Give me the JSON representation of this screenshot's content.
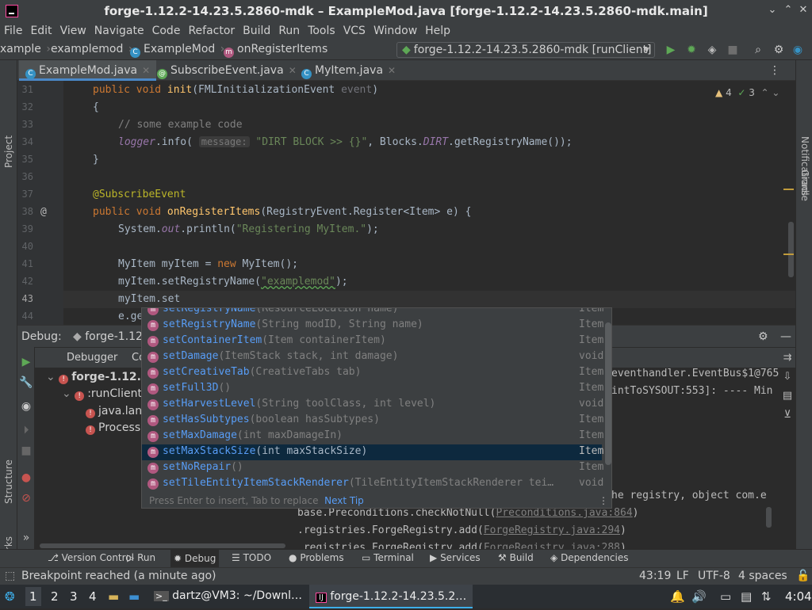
{
  "window": {
    "title": "forge-1.12.2-14.23.5.2860-mdk – ExampleMod.java [forge-1.12.2-14.23.5.2860-mdk.main]"
  },
  "menu": [
    "File",
    "Edit",
    "View",
    "Navigate",
    "Code",
    "Refactor",
    "Build",
    "Run",
    "Tools",
    "VCS",
    "Window",
    "Help"
  ],
  "breadcrumbs": {
    "c1": "xample",
    "c2": "examplemod",
    "c3": "ExampleMod",
    "c4": "onRegisterItems"
  },
  "run_config": "forge-1.12.2-14.23.5.2860-mdk [runClient]",
  "tabs": [
    "ExampleMod.java",
    "SubscribeEvent.java",
    "MyItem.java"
  ],
  "inspections": {
    "warnings": "4",
    "ok": "3"
  },
  "side_labels": {
    "project": "Project",
    "notifications": "Notifications",
    "gradle": "Gradle",
    "structure": "Structure",
    "bookmarks": "Bookmarks"
  },
  "code": {
    "line_numbers": [
      "31",
      "32",
      "33",
      "34",
      "35",
      "36",
      "37",
      "38",
      "39",
      "40",
      "41",
      "42",
      "43",
      "44"
    ],
    "l31_kw": "public void ",
    "l31_fn": "init",
    "l31_rest": "(FMLInitializationEvent ",
    "l31_par": "event",
    ")": ")",
    "l32": "{",
    "l33": "// some example code",
    "l34_a": "logger",
    "l34_b": ".info( ",
    "l34_hint": "message:",
    "l34_str": " \"DIRT BLOCK >> {}\"",
    "l34_c": ", Blocks.",
    "l34_st": "DIRT",
    "l34_d": ".getRegistryName());",
    "l35": "}",
    "l37": "@SubscribeEvent",
    "l38_kw": "public void ",
    "l38_fn": "onRegisterItems",
    "l38_rest": "(RegistryEvent.Register<Item> e) {",
    "l39_a": "System.",
    "l39_st": "out",
    "l39_b": ".println(",
    "l39_str": "\"Registering MyItem.\"",
    "l39_c": ");",
    "l41_a": "MyItem myItem = ",
    "l41_kw": "new ",
    "l41_b": "MyItem();",
    "l42_a": "myItem.setRegistryName(",
    "l42_str": "\"examplemod\"",
    "l42_b": ");",
    "l43": "myItem.set",
    "l44": "e.ge"
  },
  "completion": {
    "items": [
      {
        "name": "setRegistryName",
        "params": "(ResourceLocation name)",
        "ret": "Item"
      },
      {
        "name": "setRegistryName",
        "params": "(String modID, String name)",
        "ret": "Item"
      },
      {
        "name": "setContainerItem",
        "params": "(Item containerItem)",
        "ret": "Item"
      },
      {
        "name": "setDamage",
        "params": "(ItemStack stack, int damage)",
        "ret": "void"
      },
      {
        "name": "setCreativeTab",
        "params": "(CreativeTabs tab)",
        "ret": "Item"
      },
      {
        "name": "setFull3D",
        "params": "()",
        "ret": "Item"
      },
      {
        "name": "setHarvestLevel",
        "params": "(String toolClass, int level)",
        "ret": "void"
      },
      {
        "name": "setHasSubtypes",
        "params": "(boolean hasSubtypes)",
        "ret": "Item"
      },
      {
        "name": "setMaxDamage",
        "params": "(int maxDamageIn)",
        "ret": "Item"
      },
      {
        "name": "setMaxStackSize",
        "params": "(int maxStackSize)",
        "ret": "Item"
      },
      {
        "name": "setNoRepair",
        "params": "()",
        "ret": "Item"
      },
      {
        "name": "setTileEntityItemStackRenderer",
        "params": "(TileEntityItemStackRenderer tei…",
        "ret": "void"
      }
    ],
    "footer": "Press Enter to insert, Tab to replace",
    "next_tip": "Next Tip"
  },
  "debug": {
    "label": "Debug:",
    "session": "forge-1.12",
    "tab_debugger": "Debugger",
    "tab_console": "Conso",
    "tree": {
      "t1": "forge-1.12.2",
      "t2": ":runClient",
      "t3": "java.lan",
      "t4": "Process"
    },
    "console": {
      "c1": "eventhandler.EventBus$1@765",
      "c2": "intToSYSOUT:553]: ---- Min",
      "c3": "he registry, object com.e",
      "c4a": "base.Preconditions.checkNotNull(",
      "c4b": "Preconditions.java:864",
      "c4c": ")",
      "c5a": ".registries.ForgeRegistry.add(",
      "c5b": "ForgeRegistry.java:294",
      "c5c": ")",
      "c6a": ".registries.ForgeRegistry.add(",
      "c6b": "ForgeRegistry.java:288",
      "c6c": ")"
    }
  },
  "bottom_tools": [
    "Version Control",
    "Run",
    "Debug",
    "TODO",
    "Problems",
    "Terminal",
    "Services",
    "Build",
    "Dependencies"
  ],
  "status": {
    "message": "Breakpoint reached (a minute ago)",
    "position": "43:19",
    "line_sep": "LF",
    "encoding": "UTF-8",
    "indent": "4 spaces"
  },
  "taskbar": {
    "ws1": "1",
    "ws2": "2",
    "ws3": "3",
    "ws4": "4",
    "terminal": "dartz@VM3: ~/Downl…",
    "ide": "forge-1.12.2-14.23.5.2…",
    "clock": "4:04"
  }
}
